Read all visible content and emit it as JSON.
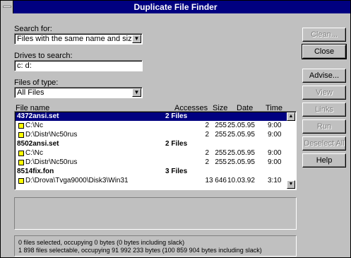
{
  "window": {
    "title": "Duplicate File Finder"
  },
  "search": {
    "label": "Search for:",
    "value": "Files with the same name and size"
  },
  "drives": {
    "label": "Drives to search:",
    "value": "c: d:"
  },
  "filetype": {
    "label": "Files of type:",
    "value": "All Files"
  },
  "buttons": {
    "clean": "Clean...",
    "close": "Close",
    "advise": "Advise...",
    "view": "View",
    "links": "Links",
    "run": "Run",
    "deselect_all": "Deselect All",
    "help": "Help"
  },
  "columns": {
    "file_name": "File name",
    "accesses": "Accesses",
    "size": "Size",
    "date": "Date",
    "time": "Time"
  },
  "rows": [
    {
      "type": "group",
      "name": "4372ansi.set",
      "count": "2 Files",
      "selected": true
    },
    {
      "type": "file",
      "name": "C:\\Nc",
      "accesses": "2",
      "size": "255",
      "date": "25.05.95",
      "time": "9:00"
    },
    {
      "type": "file",
      "name": "D:\\Distr\\Nc50rus",
      "accesses": "2",
      "size": "255",
      "date": "25.05.95",
      "time": "9:00"
    },
    {
      "type": "group",
      "name": "8502ansi.set",
      "count": "2 Files"
    },
    {
      "type": "file",
      "name": "C:\\Nc",
      "accesses": "2",
      "size": "255",
      "date": "25.05.95",
      "time": "9:00"
    },
    {
      "type": "file",
      "name": "D:\\Distr\\Nc50rus",
      "accesses": "2",
      "size": "255",
      "date": "25.05.95",
      "time": "9:00"
    },
    {
      "type": "group",
      "name": "8514fix.fon",
      "count": "3 Files"
    },
    {
      "type": "file",
      "name": "D:\\Drova\\Tvga9000\\Disk3\\Win31",
      "accesses": "1",
      "size": "3 646",
      "date": "10.03.92",
      "time": "3:10"
    }
  ],
  "status": {
    "line1": "0 files selected, occupying 0 bytes (0 bytes including slack)",
    "line2": "1 898 files selectable, occupying 91 992 233 bytes (100 859 904 bytes including slack)"
  },
  "colors": {
    "titlebar": "#000080",
    "face": "#c0c0c0",
    "selection": "#000080",
    "folder": "#ffff00"
  },
  "icons": {
    "sysmenu": "system-menu-icon",
    "dropdown": "dropdown-arrow-icon",
    "folder": "folder-icon",
    "scroll_up": "scroll-up-arrow-icon",
    "scroll_down": "scroll-down-arrow-icon"
  }
}
